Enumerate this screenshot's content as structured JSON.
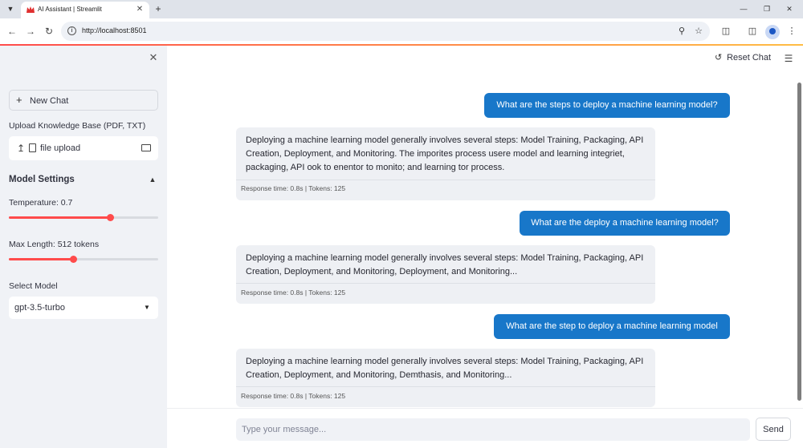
{
  "browser": {
    "tab_title": "AI Assistant | Streamlit",
    "url": "http://localhost:8501",
    "icons": [
      "tab-search-icon",
      "app-crown-icon",
      "close-icon",
      "plus-icon",
      "minimize-icon",
      "restore-icon",
      "close-window-icon",
      "back-icon",
      "forward-icon",
      "reload-icon",
      "site-info-icon",
      "zoom-icon",
      "star-icon",
      "extensions-icon",
      "side-panel-icon",
      "profile-icon",
      "more-icon"
    ]
  },
  "sidebar": {
    "new_chat_label": "New Chat",
    "upload_label": "Upload Knowledge Base (PDF, TXT)",
    "upload_text": "file upload",
    "settings_title": "Model Settings",
    "temperature_label": "Temperature: 0.7",
    "temperature_value": 0.7,
    "temperature_fraction": 0.68,
    "max_length_label": "Max Length: 512 tokens",
    "max_length_value": 512,
    "max_length_fraction": 0.43,
    "model_label": "Select Model",
    "model_value": "gpt-3.5-turbo"
  },
  "header": {
    "reset_label": "Reset Chat"
  },
  "messages": [
    {
      "role": "user",
      "text": "What are the steps to deploy a machine learning model?"
    },
    {
      "role": "assistant",
      "text": "Deploying a machine learning model generally involves several steps: Model Training, Packaging, API Creation, Deployment, and Monitoring. The imporites process usere model and learning integriet, packaging, API ook to enentor to monito; and learning tor process.",
      "meta": "Response time: 0.8s | Tokens: 125"
    },
    {
      "role": "user",
      "text": "What are the deploy a machine learning model?"
    },
    {
      "role": "assistant",
      "text": "Deploying a machine learning model generally involves several steps: Model Training, Packaging, API Creation, Deployment, and Monitoring, Deployment, and Monitoring...",
      "meta": "Response time: 0.8s | Tokens: 125"
    },
    {
      "role": "user",
      "text": "What are the step to deploy a machine learning model"
    },
    {
      "role": "assistant",
      "text": "Deploying a  machine learning model generally involves several steps: Model Training, Packaging, API Creation, Deployment, and Monitoring, Demthasis, and Monitoring...",
      "meta": "Response time: 0.8s | Tokens: 125"
    }
  ],
  "input": {
    "placeholder": "Type your message...",
    "send_label": "Send"
  },
  "colors": {
    "accent": "#ff4b4b",
    "user_bubble": "#1877c9",
    "sidebar_bg": "#f0f2f6",
    "assistant_bubble": "#eef0f4"
  }
}
